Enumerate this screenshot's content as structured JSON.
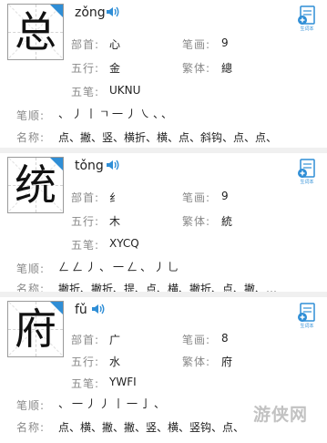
{
  "labels": {
    "bushou": "部首:",
    "bihua": "笔画:",
    "wuxing": "五行:",
    "fanti": "繁体:",
    "wubi": "五笔:",
    "bishun": "笔顺:",
    "mingcheng": "名称:",
    "add_label": "生词本"
  },
  "cards": [
    {
      "char": "总",
      "pinyin": "zǒng",
      "bushou": "心",
      "bihua": "9",
      "wuxing": "金",
      "fanti": "總",
      "wubi": "UKNU",
      "bishun": "、丿丨ㄱ一丿㇏、、",
      "mingcheng": "点、撇、竖、横折、横、点、斜钩、点、点、"
    },
    {
      "char": "统",
      "pinyin": "tǒng",
      "bushou": "纟",
      "bihua": "9",
      "wuxing": "木",
      "fanti": "統",
      "wubi": "XYCQ",
      "bishun": "ㄥㄥ丿、一ㄥ、丿乚",
      "mingcheng": "撇折、撇折、提、点、横、撇折、点、撇、…"
    },
    {
      "char": "府",
      "pinyin": "fǔ",
      "bushou": "广",
      "bihua": "8",
      "wuxing": "水",
      "fanti": "府",
      "wubi": "YWFI",
      "bishun": "、一丿丿丨一亅、",
      "mingcheng": "点、横、撇、撇、竖、横、竖钩、点、"
    }
  ],
  "watermark": "游侠网",
  "colors": {
    "accent": "#2f8ed6",
    "label": "#8a8a8a",
    "text": "#222222"
  }
}
